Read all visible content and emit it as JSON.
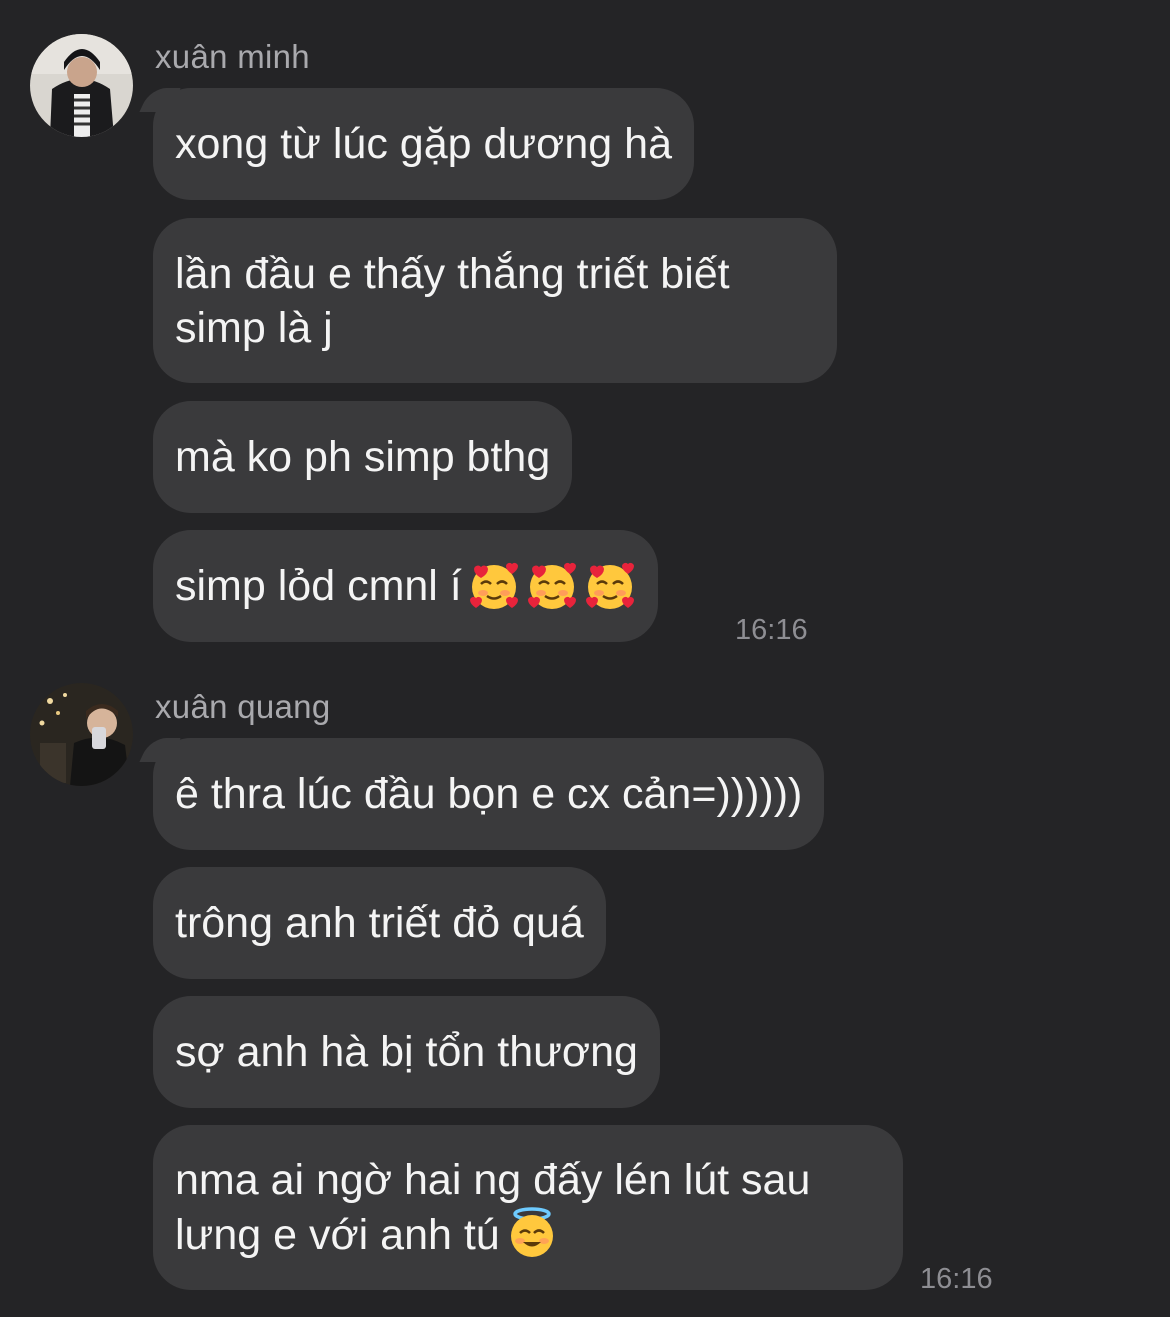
{
  "groups": [
    {
      "sender": "xuân minh",
      "messages": [
        "xong từ lúc gặp dương hà",
        "lần đầu e thấy thắng triết biết simp là j",
        "mà ko ph simp bthg",
        "simp lỏd cmnl í"
      ],
      "time": "16:16"
    },
    {
      "sender": "xuân quang",
      "messages": [
        "ê thra lúc đầu bọn e cx cản=))))))",
        "trông anh triết đỏ quá",
        "sợ anh hà bị tổn thương",
        "nma ai ngờ hai ng đấy lén lút sau lưng e với anh tú"
      ],
      "time": "16:16"
    }
  ],
  "icons": {
    "hearts_emoji": "smiling-face-with-hearts-icon",
    "halo_emoji": "smiling-face-with-halo-icon"
  },
  "colors": {
    "background": "#242426",
    "bubble": "#3a3a3c",
    "sender_name": "#a9a9ad",
    "timestamp": "#8e8e93"
  }
}
